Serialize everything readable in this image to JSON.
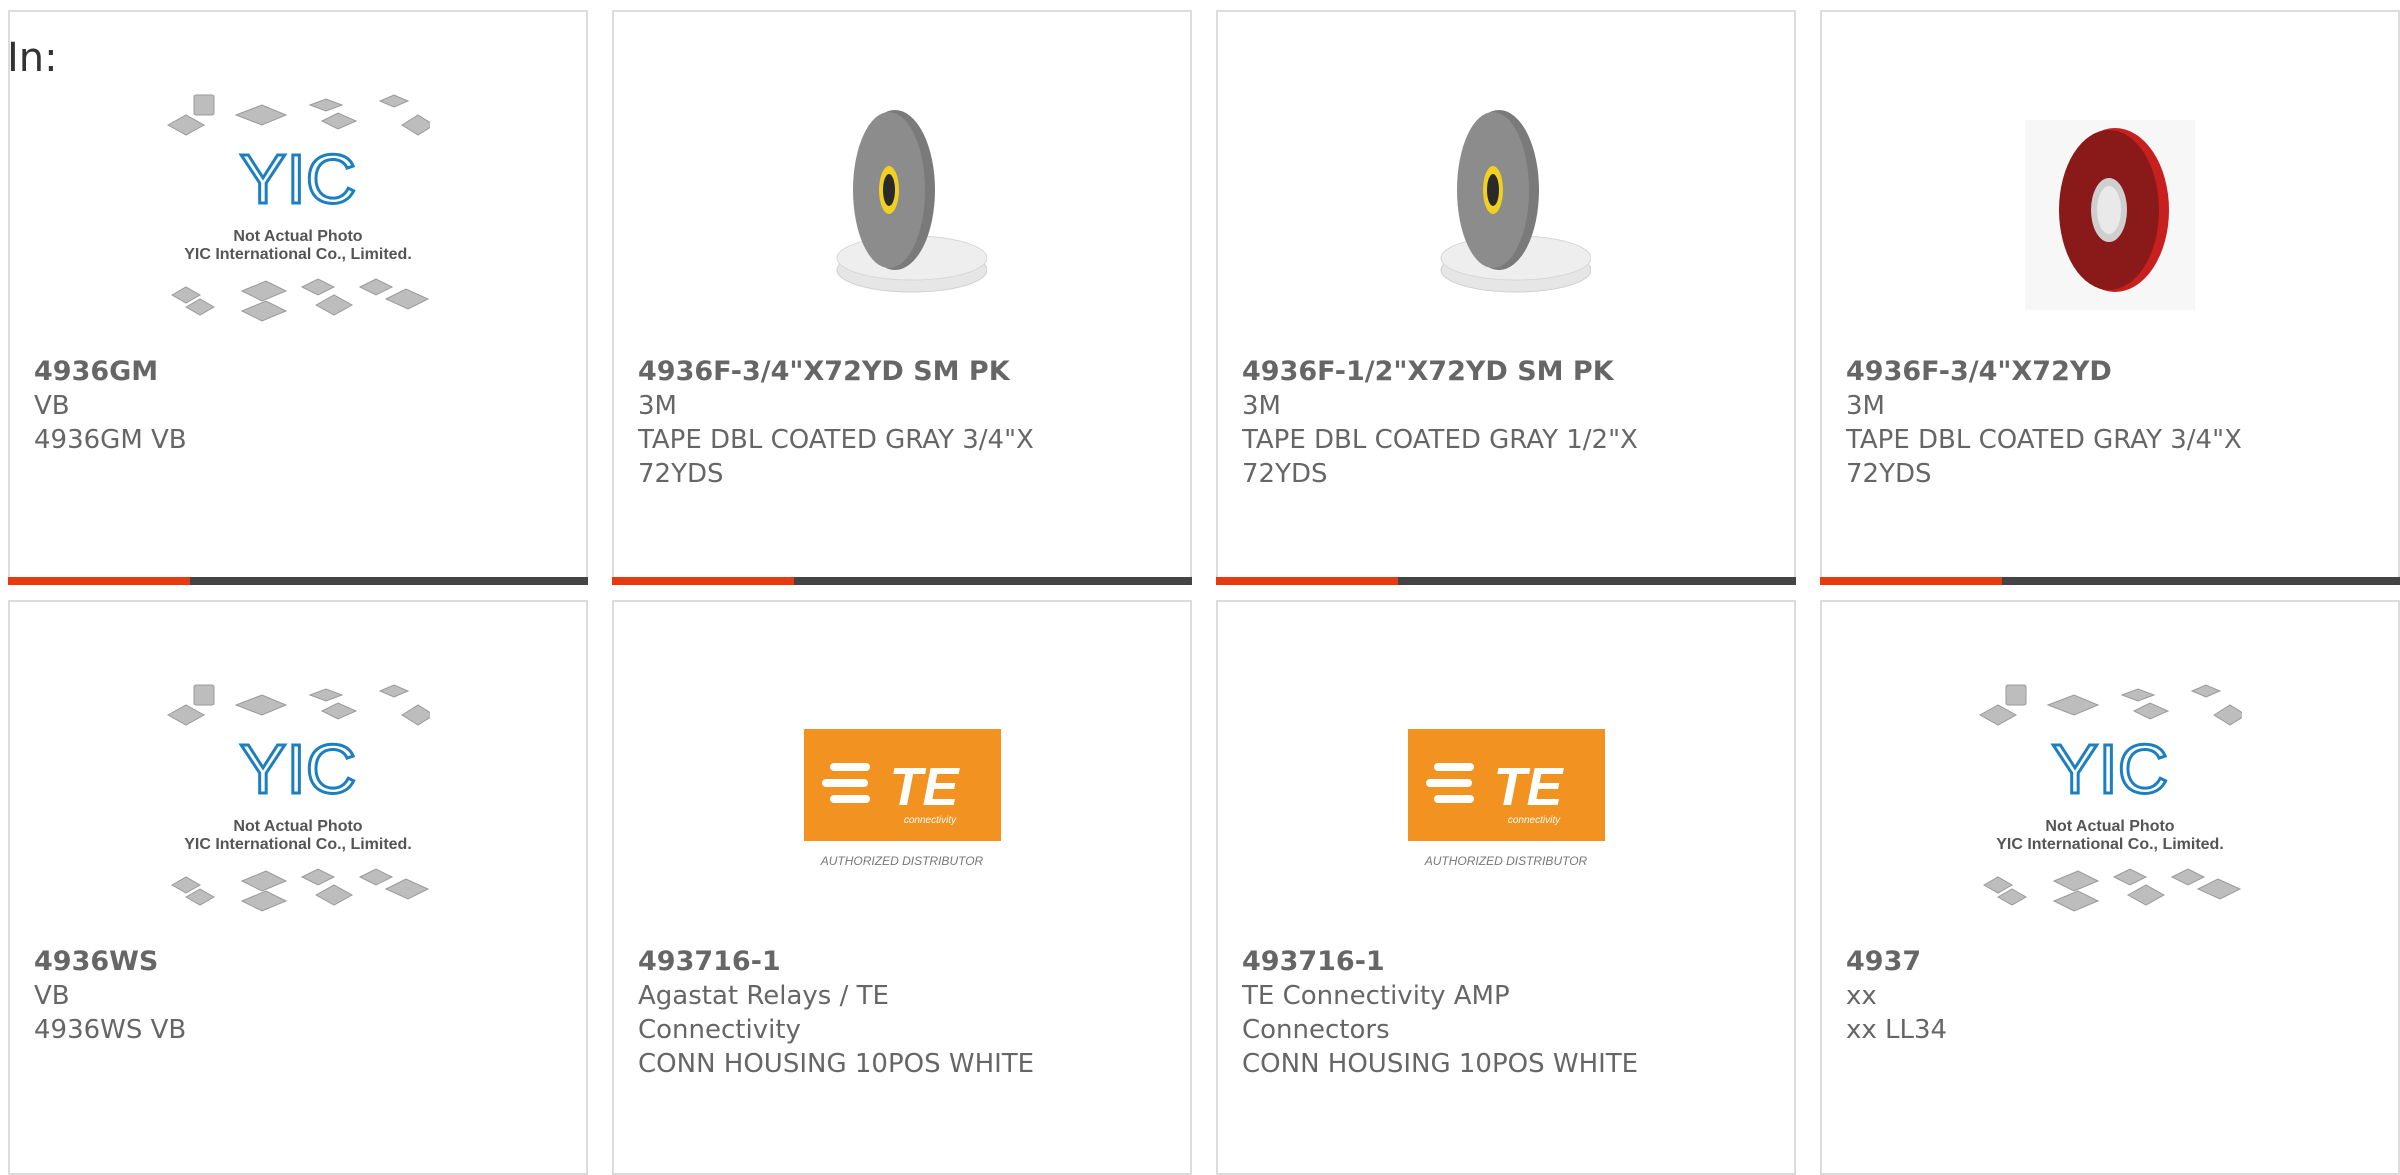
{
  "header": {
    "in_label": "In:"
  },
  "cards": [
    {
      "part": "4936GM",
      "mfr": "VB",
      "desc": "4936GM VB",
      "image": "yic-placeholder"
    },
    {
      "part": "4936F-3/4\"X72YD SM PK",
      "mfr": "3M",
      "desc": "TAPE DBL COATED GRAY 3/4\"X 72YDS",
      "image": "gray-tape-roll"
    },
    {
      "part": "4936F-1/2\"X72YD SM PK",
      "mfr": "3M",
      "desc": "TAPE DBL COATED GRAY 1/2\"X 72YDS",
      "image": "gray-tape-roll"
    },
    {
      "part": "4936F-3/4\"X72YD",
      "mfr": "3M",
      "desc": "TAPE DBL COATED GRAY 3/4\"X 72YDS",
      "image": "red-tape-roll"
    },
    {
      "part": "4936WS",
      "mfr": "VB",
      "desc": "4936WS VB",
      "image": "yic-placeholder"
    },
    {
      "part": "493716-1",
      "mfr": "Agastat Relays / TE Connectivity",
      "desc": "CONN HOUSING 10POS WHITE",
      "image": "te-logo"
    },
    {
      "part": "493716-1",
      "mfr": "TE Connectivity AMP Connectors",
      "desc": "CONN HOUSING 10POS WHITE",
      "image": "te-logo"
    },
    {
      "part": "4937",
      "mfr": "xx",
      "desc": "xx LL34",
      "image": "yic-placeholder"
    }
  ],
  "placeholder": {
    "line1": "Not Actual Photo",
    "line2": "YIC International Co., Limited.",
    "logo": "YIC"
  },
  "te_logo": {
    "wordmark": "TE",
    "sub": "connectivity",
    "tagline": "AUTHORIZED DISTRIBUTOR"
  },
  "colors": {
    "accent": "#e63b10",
    "bar": "#444444",
    "te_orange": "#f29220",
    "yic_blue": "#1b7fc0"
  }
}
